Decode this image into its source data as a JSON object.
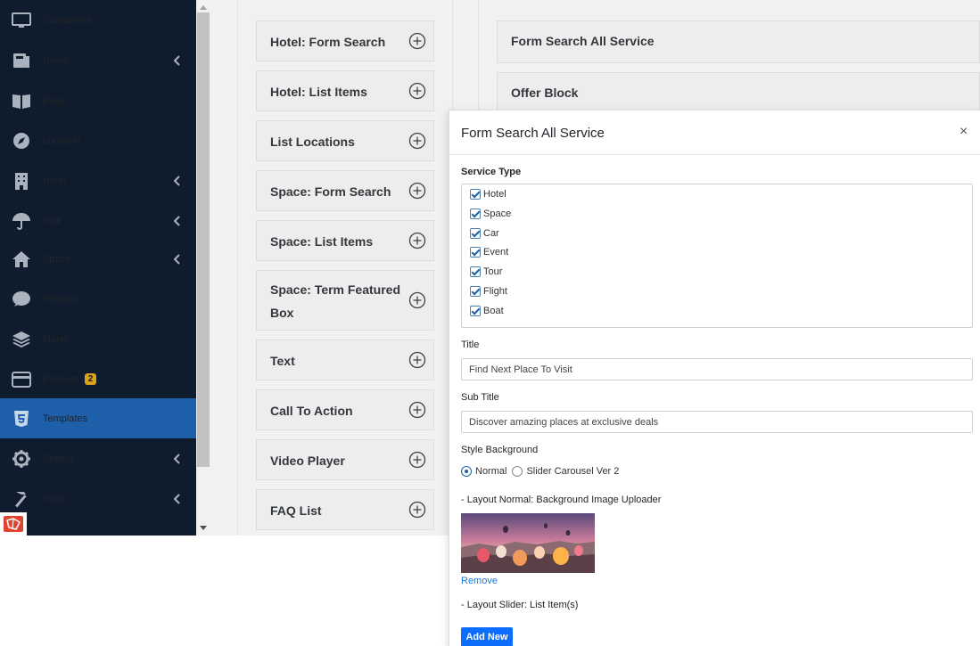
{
  "sidebar": {
    "items": [
      {
        "label": "Dashboard",
        "icon": "monitor-icon",
        "has_chevron": false
      },
      {
        "label": "News",
        "icon": "newspaper-icon",
        "has_chevron": true
      },
      {
        "label": "Page",
        "icon": "book-icon",
        "has_chevron": false
      },
      {
        "label": "Location",
        "icon": "compass-icon",
        "has_chevron": false
      },
      {
        "label": "Hotel",
        "icon": "building-icon",
        "has_chevron": true
      },
      {
        "label": "Tour",
        "icon": "umbrella-icon",
        "has_chevron": true
      },
      {
        "label": "Space",
        "icon": "home-icon",
        "has_chevron": true
      },
      {
        "label": "Reviews",
        "icon": "comment-icon",
        "has_chevron": false
      },
      {
        "label": "Menu",
        "icon": "layers-icon",
        "has_chevron": false
      },
      {
        "label": "Payouts",
        "icon": "credit-card-icon",
        "has_chevron": false,
        "badge": "2"
      },
      {
        "label": "Templates",
        "icon": "html5-icon",
        "has_chevron": false,
        "active": true
      },
      {
        "label": "Setting",
        "icon": "gear-icon",
        "has_chevron": true
      },
      {
        "label": "Tools",
        "icon": "hammer-icon",
        "has_chevron": true
      }
    ]
  },
  "blocks": [
    {
      "label": "Hotel: Form Search"
    },
    {
      "label": "Hotel: List Items"
    },
    {
      "label": "List Locations"
    },
    {
      "label": "Space: Form Search"
    },
    {
      "label": "Space: List Items"
    },
    {
      "label": "Space: Term Featured",
      "label2": "Box"
    },
    {
      "label": "Text"
    },
    {
      "label": "Call To Action"
    },
    {
      "label": "Video Player"
    },
    {
      "label": "FAQ List"
    }
  ],
  "template_blocks": [
    {
      "label": "Form Search All Service"
    },
    {
      "label": "Offer Block"
    }
  ],
  "modal": {
    "title": "Form Search All Service",
    "close_glyph": "×",
    "service_type_label": "Service Type",
    "services": [
      "Hotel",
      "Space",
      "Car",
      "Event",
      "Tour",
      "Flight",
      "Boat"
    ],
    "title_label": "Title",
    "title_value": "Find Next Place To Visit",
    "subtitle_label": "Sub Title",
    "subtitle_value": "Discover amazing places at exclusive deals",
    "style_label": "Style Background",
    "style_options": [
      "Normal",
      "Slider Carousel Ver 2"
    ],
    "style_selected": "Normal",
    "layout_normal_label": "- Layout Normal: Background Image Uploader",
    "remove_label": "Remove",
    "layout_slider_label": "- Layout Slider: List Item(s)",
    "add_new_label": "Add New"
  },
  "colors": {
    "sidebar_bg": "#0f1c2e",
    "sidebar_active": "#1d5fa8",
    "badge": "#d9a21b",
    "primary_button": "#0d6efd",
    "link": "#1b7ad8"
  }
}
